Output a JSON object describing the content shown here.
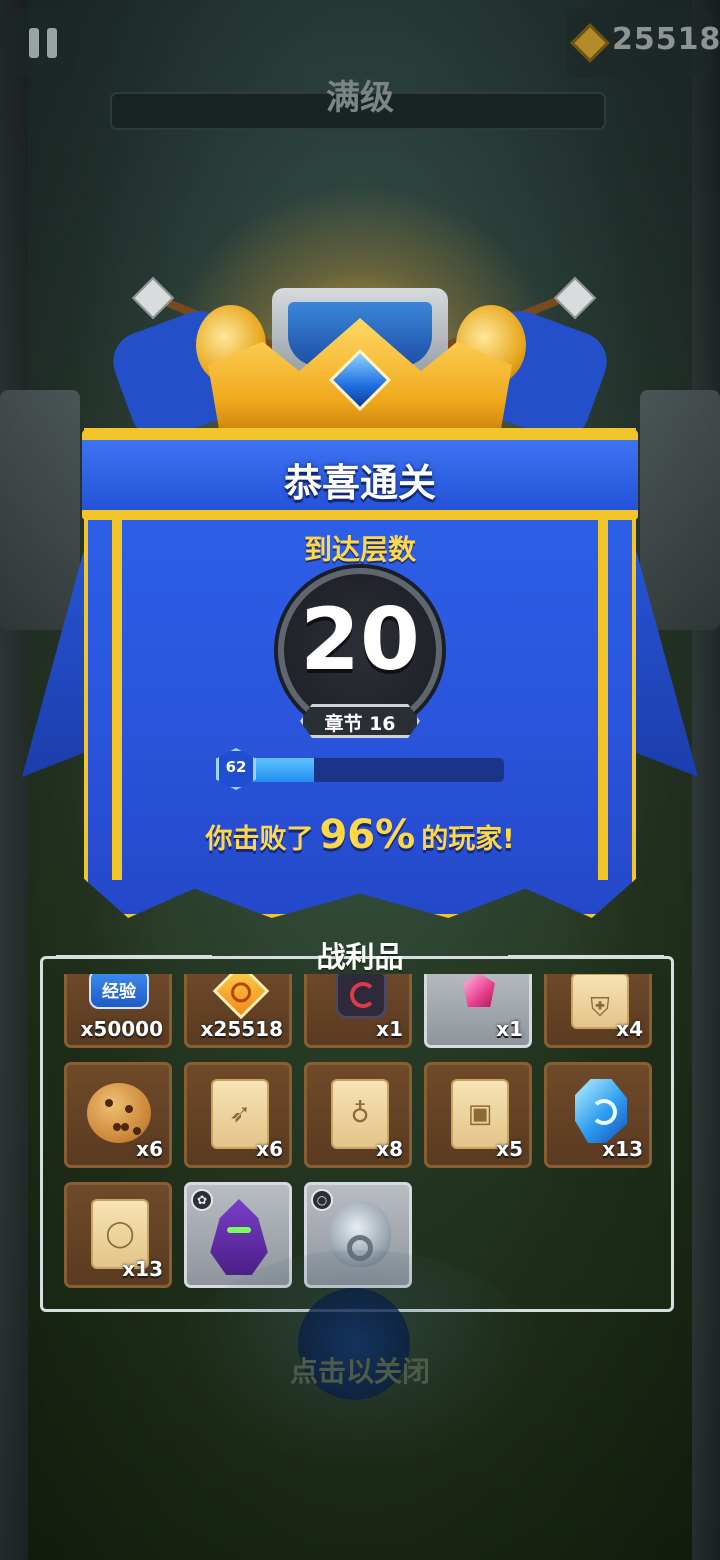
{
  "hud": {
    "currency_amount": "25518",
    "level_status": "满级"
  },
  "result": {
    "title": "恭喜通关",
    "floors_label": "到达层数",
    "floor_value": "20",
    "chapter": "章节 16",
    "player_level": "62",
    "xp_progress": 0.29,
    "defeat_prefix": "你击败了",
    "defeat_percent": "96%",
    "defeat_suffix": "的玩家!"
  },
  "loot": {
    "title": "战利品",
    "items": [
      {
        "icon": "exp-icon",
        "label": "经验",
        "count": "x50000"
      },
      {
        "icon": "gold-coin-icon",
        "count": "x25518"
      },
      {
        "icon": "rune-icon",
        "count": "x1"
      },
      {
        "icon": "pink-gem-icon",
        "count": "x1"
      },
      {
        "icon": "armor-scroll-icon",
        "count": "x4"
      },
      {
        "icon": "cookie-icon",
        "count": "x6"
      },
      {
        "icon": "bow-scroll-icon",
        "count": "x6"
      },
      {
        "icon": "necklace-scroll-icon",
        "count": "x8"
      },
      {
        "icon": "book-scroll-icon",
        "count": "x5"
      },
      {
        "icon": "blue-gem-icon",
        "count": "x13"
      },
      {
        "icon": "ring-scroll-icon",
        "count": "x13"
      },
      {
        "icon": "pet-icon"
      },
      {
        "icon": "lion-ring-icon"
      }
    ]
  },
  "close_hint": "点击以关闭"
}
